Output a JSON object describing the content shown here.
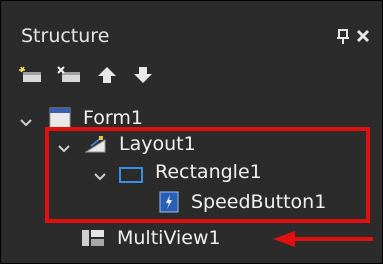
{
  "panel": {
    "title": "Structure",
    "pin_icon": "pin-icon",
    "close_icon": "close-icon"
  },
  "toolbar": {
    "buttons": [
      {
        "icon": "new-item-icon"
      },
      {
        "icon": "delete-item-icon"
      },
      {
        "icon": "move-up-icon"
      },
      {
        "icon": "move-down-icon"
      }
    ]
  },
  "tree": {
    "form": {
      "label": "Form1",
      "icon": "form-icon",
      "expanded": true
    },
    "layout": {
      "label": "Layout1",
      "icon": "layout-icon",
      "expanded": true
    },
    "rectangle": {
      "label": "Rectangle1",
      "icon": "rectangle-icon",
      "expanded": true
    },
    "speedbutton": {
      "label": "SpeedButton1",
      "icon": "speedbutton-icon"
    },
    "multiview": {
      "label": "MultiView1",
      "icon": "multiview-icon"
    }
  },
  "annotation": {
    "highlight_color": "#e01010",
    "arrow_color": "#e01010"
  },
  "colors": {
    "background": "#2b2b2b",
    "text": "#f0f0f0",
    "accent": "#3a8ee6"
  }
}
